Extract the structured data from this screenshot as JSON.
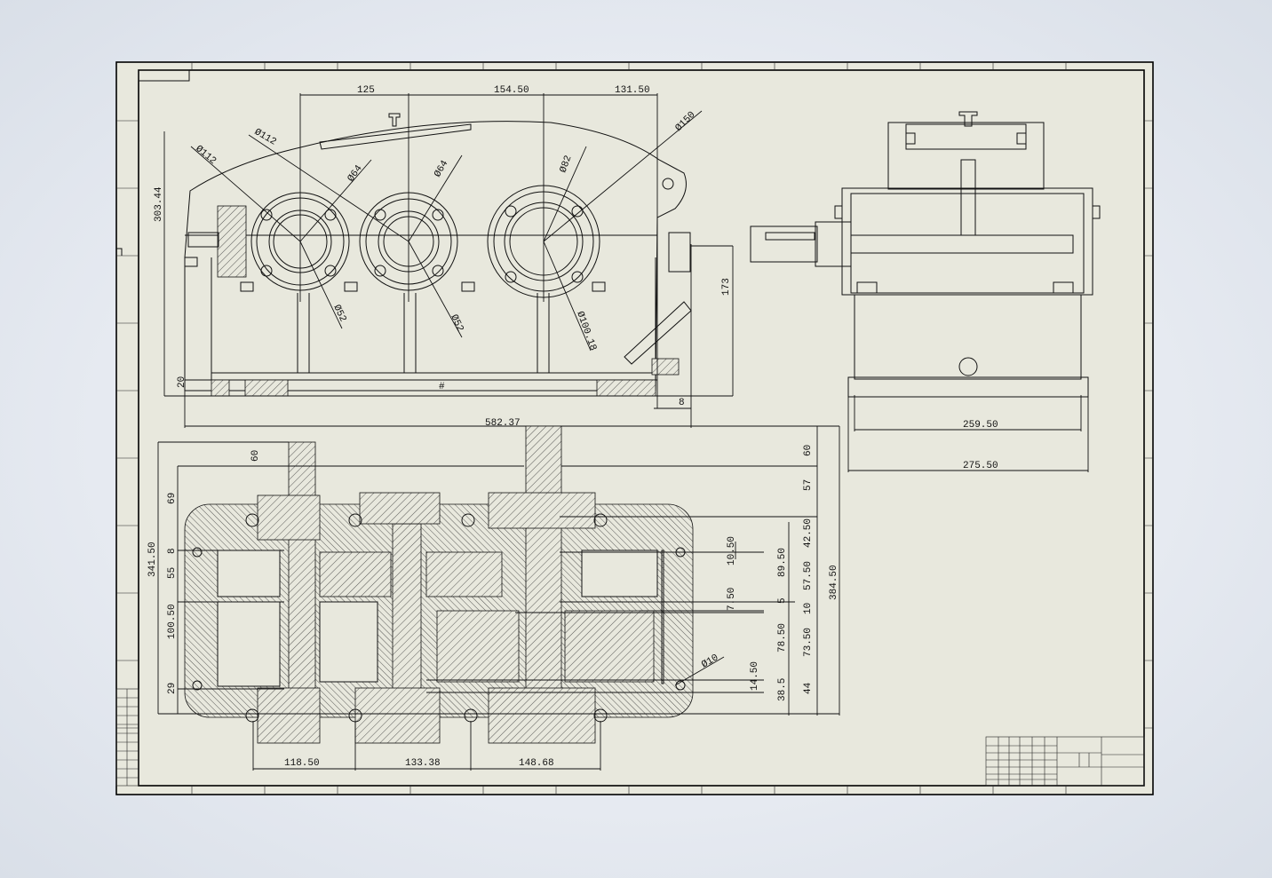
{
  "colors": {
    "sheet": "#e8e8dd",
    "line": "#111111",
    "backdrop": "#e6eaf1"
  },
  "front_view": {
    "dims": {
      "d125": "125",
      "d154": "154.50",
      "d131": "131.50",
      "d303": "303.44",
      "d173": "173",
      "d20": "20",
      "d582": "582.37",
      "d8": "8",
      "mark": "#"
    },
    "diameters": {
      "phi112a": "Ø112",
      "phi112b": "Ø112",
      "phi64a": "Ø64",
      "phi64b": "Ø64",
      "phi82": "Ø82",
      "phi150": "Ø150",
      "phi52a": "Ø52",
      "phi52b": "Ø52",
      "phi100": "Ø100.18"
    }
  },
  "side_view": {
    "dims": {
      "d259": "259.50",
      "d275": "275.50"
    }
  },
  "top_view": {
    "dims": {
      "d60a": "60",
      "d60b": "60",
      "d69": "69",
      "d341": "341.50",
      "d8": "8",
      "d55": "55",
      "d100": "100.50",
      "d29": "29",
      "d57": "57",
      "d42": "42.50",
      "d10_50": "10.50",
      "d89": "89.50",
      "d57b": "57.50",
      "d5": "5",
      "d7": "7.50",
      "d10": "10",
      "d78": "78.50",
      "d73": "73.50",
      "d14": "14.50",
      "d38": "38.5",
      "d44": "44",
      "d384": "384.50",
      "phi10": "Ø10",
      "d118": "118.50",
      "d133": "133.38",
      "d148": "148.68"
    }
  }
}
